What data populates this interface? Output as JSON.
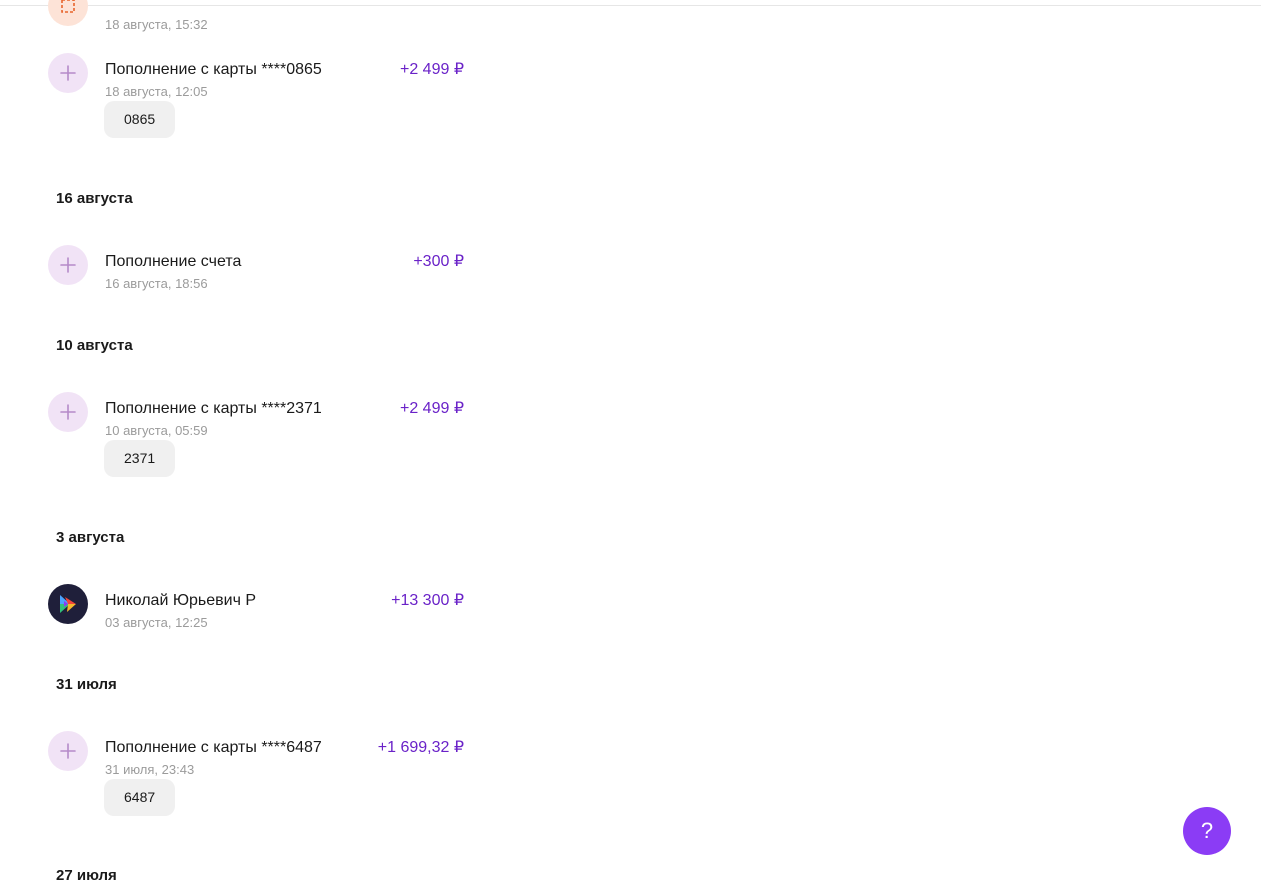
{
  "transactions": {
    "t0": {
      "date": "18 августа, 15:32",
      "icon": "receipt-icon"
    },
    "t1": {
      "title": "Пополнение с карты ****0865",
      "date": "18 августа, 12:05",
      "amount": "+2 499 ₽",
      "chip": "0865",
      "icon": "plus-icon"
    },
    "t2": {
      "title": "Пополнение счета",
      "date": "16 августа, 18:56",
      "amount": "+300 ₽",
      "icon": "plus-icon"
    },
    "t3": {
      "title": "Пополнение с карты ****2371",
      "date": "10 августа, 05:59",
      "amount": "+2 499 ₽",
      "chip": "2371",
      "icon": "plus-icon"
    },
    "t4": {
      "title": "Николай Юрьевич Р",
      "date": "03 августа, 12:25",
      "amount": "+13 300 ₽",
      "icon": "bank-logo-icon"
    },
    "t5": {
      "title": "Пополнение с карты ****6487",
      "date": "31 июля, 23:43",
      "amount": "+1 699,32 ₽",
      "chip": "6487",
      "icon": "plus-icon"
    }
  },
  "groups": {
    "g1": "16 августа",
    "g2": "10 августа",
    "g3": "3 августа",
    "g4": "31 июля",
    "g5": "27 июля"
  },
  "help": {
    "label": "?",
    "icon": "question-icon"
  },
  "colors": {
    "accent": "#8b3cf5",
    "amount": "#6a22c8",
    "icon_bg": "#f1e3f6",
    "chip_bg": "#f0f0f0"
  }
}
